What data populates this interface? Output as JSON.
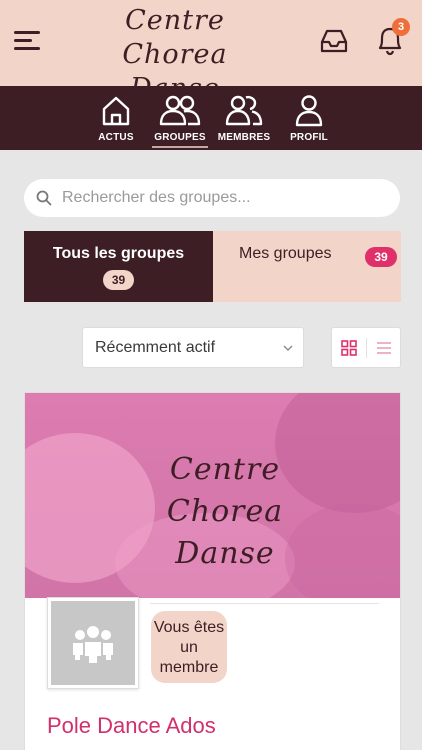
{
  "header": {
    "logo_line1": "Centre",
    "logo_line2": "Chorea Danse",
    "notification_count": "3"
  },
  "nav": {
    "items": [
      {
        "label": "ACTUS",
        "icon": "home-icon"
      },
      {
        "label": "GROUPES",
        "icon": "groups-icon",
        "active": true
      },
      {
        "label": "MEMBRES",
        "icon": "members-icon"
      },
      {
        "label": "PROFIL",
        "icon": "profile-icon"
      }
    ]
  },
  "search": {
    "placeholder": "Rechercher des groupes..."
  },
  "tabs": {
    "all": {
      "label": "Tous les groupes",
      "count": "39"
    },
    "mine": {
      "label": "Mes groupes",
      "count": "39"
    }
  },
  "filter": {
    "sort_value": "Récemment actif"
  },
  "group_card": {
    "cover_line1": "Centre",
    "cover_line2": "Chorea Danse",
    "membership_status": "Vous êtes un membre",
    "name": "Pole Dance Ados"
  },
  "colors": {
    "header_bg": "#f2d4c9",
    "nav_bg": "#3c1e24",
    "accent_pink": "#e0306a",
    "notification_badge": "#ef6f3a"
  }
}
